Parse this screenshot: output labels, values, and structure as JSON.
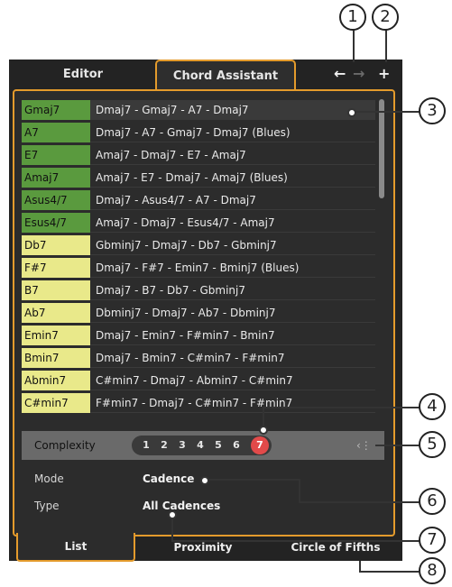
{
  "tabs": [
    "Editor",
    "Chord Assistant"
  ],
  "nav": {
    "back": "←",
    "forward": "→",
    "add": "+"
  },
  "rows": [
    {
      "chord": "Gmaj7",
      "progression": "Dmaj7 - Gmaj7 - A7 - Dmaj7",
      "color": "#5a9a3e"
    },
    {
      "chord": "A7",
      "progression": "Dmaj7 - A7 - Gmaj7 - Dmaj7 (Blues)",
      "color": "#5a9a3e"
    },
    {
      "chord": "E7",
      "progression": "Amaj7 - Dmaj7 - E7 - Amaj7",
      "color": "#5a9a3e"
    },
    {
      "chord": "Amaj7",
      "progression": "Amaj7 - E7 - Dmaj7 - Amaj7 (Blues)",
      "color": "#5a9a3e"
    },
    {
      "chord": "Asus4/7",
      "progression": "Dmaj7 - Asus4/7 - A7 - Dmaj7",
      "color": "#5a9a3e"
    },
    {
      "chord": "Esus4/7",
      "progression": "Amaj7 - Dmaj7 - Esus4/7 - Amaj7",
      "color": "#5a9a3e"
    },
    {
      "chord": "Db7",
      "progression": "Gbminj7 - Dmaj7 - Db7 - Gbminj7",
      "color": "#e9e98a"
    },
    {
      "chord": "F#7",
      "progression": "Dmaj7 - F#7 - Emin7 - Bminj7 (Blues)",
      "color": "#e9e98a"
    },
    {
      "chord": "B7",
      "progression": "Dmaj7 - B7 - Db7 - Gbminj7",
      "color": "#e9e98a"
    },
    {
      "chord": "Ab7",
      "progression": "Dbminj7 - Dmaj7 - Ab7 - Dbminj7",
      "color": "#e9e98a"
    },
    {
      "chord": "Emin7",
      "progression": "Dmaj7 - Emin7 - F#min7 - Bmin7",
      "color": "#e9e98a"
    },
    {
      "chord": "Bmin7",
      "progression": "Dmaj7 - Bmin7 - C#min7 - F#min7",
      "color": "#e9e98a"
    },
    {
      "chord": "Abmin7",
      "progression": "C#min7 - Dmaj7 - Abmin7 - C#min7",
      "color": "#e9e98a"
    },
    {
      "chord": "C#min7",
      "progression": "F#min7 - Dmaj7 - C#min7 - F#min7",
      "color": "#e9e98a"
    }
  ],
  "complexity": {
    "label": "Complexity",
    "levels": [
      "1",
      "2",
      "3",
      "4",
      "5",
      "6",
      "7"
    ],
    "selected": "7"
  },
  "mode": {
    "label": "Mode",
    "value": "Cadence"
  },
  "type": {
    "label": "Type",
    "value": "All Cadences"
  },
  "bottom_tabs": [
    "List",
    "Proximity",
    "Circle of Fifths"
  ],
  "callouts": [
    "1",
    "2",
    "3",
    "4",
    "5",
    "6",
    "7",
    "8"
  ]
}
